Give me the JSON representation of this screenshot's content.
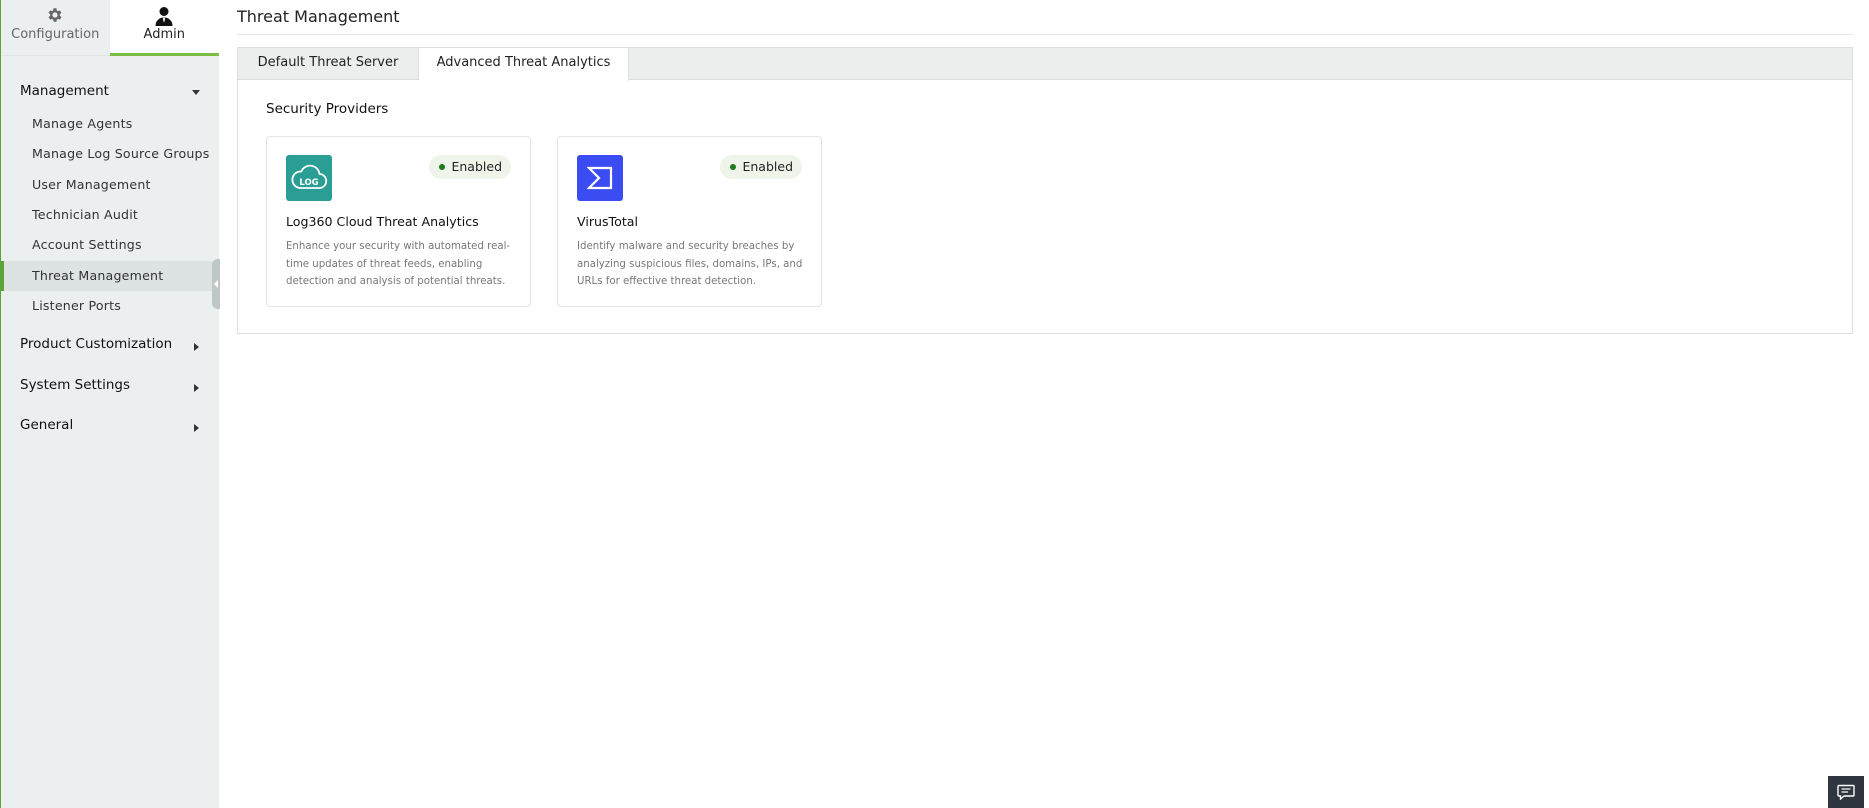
{
  "sidebar": {
    "tabs": [
      {
        "label": "Configuration",
        "icon": "gear-icon",
        "active": false
      },
      {
        "label": "Admin",
        "icon": "user-icon",
        "active": true
      }
    ],
    "groups": {
      "management": {
        "label": "Management",
        "expanded": true,
        "items": [
          {
            "label": "Manage Agents"
          },
          {
            "label": "Manage Log Source Groups"
          },
          {
            "label": "User Management"
          },
          {
            "label": "Technician Audit"
          },
          {
            "label": "Account Settings"
          },
          {
            "label": "Threat Management",
            "active": true
          },
          {
            "label": "Listener Ports"
          }
        ]
      },
      "product_customization": {
        "label": "Product Customization",
        "expanded": false
      },
      "system_settings": {
        "label": "System Settings",
        "expanded": false
      },
      "general": {
        "label": "General",
        "expanded": false
      }
    }
  },
  "main": {
    "title": "Threat Management",
    "tabs": [
      {
        "label": "Default Threat Server",
        "active": false
      },
      {
        "label": "Advanced Threat Analytics",
        "active": true
      }
    ],
    "section_title": "Security Providers",
    "providers": [
      {
        "name": "Log360 Cloud Threat Analytics",
        "logo_text": "LOG",
        "logo_icon": "cloud-icon",
        "status": "Enabled",
        "description": "Enhance your security with automated real-time updates of threat feeds, enabling detection and analysis of potential threats."
      },
      {
        "name": "VirusTotal",
        "logo_icon": "sigma-icon",
        "status": "Enabled",
        "description": "Identify malware and security breaches by analyzing suspicious files, domains, IPs, and URLs for effective threat detection."
      }
    ]
  },
  "colors": {
    "accent_green": "#7cbf44",
    "sidebar_bg": "#ecefef",
    "log360_logo_bg": "#2a9d94",
    "virustotal_logo_bg": "#3b4cf3",
    "enabled_dot": "#1e7a1e",
    "chat_button_bg": "#2f3640"
  }
}
